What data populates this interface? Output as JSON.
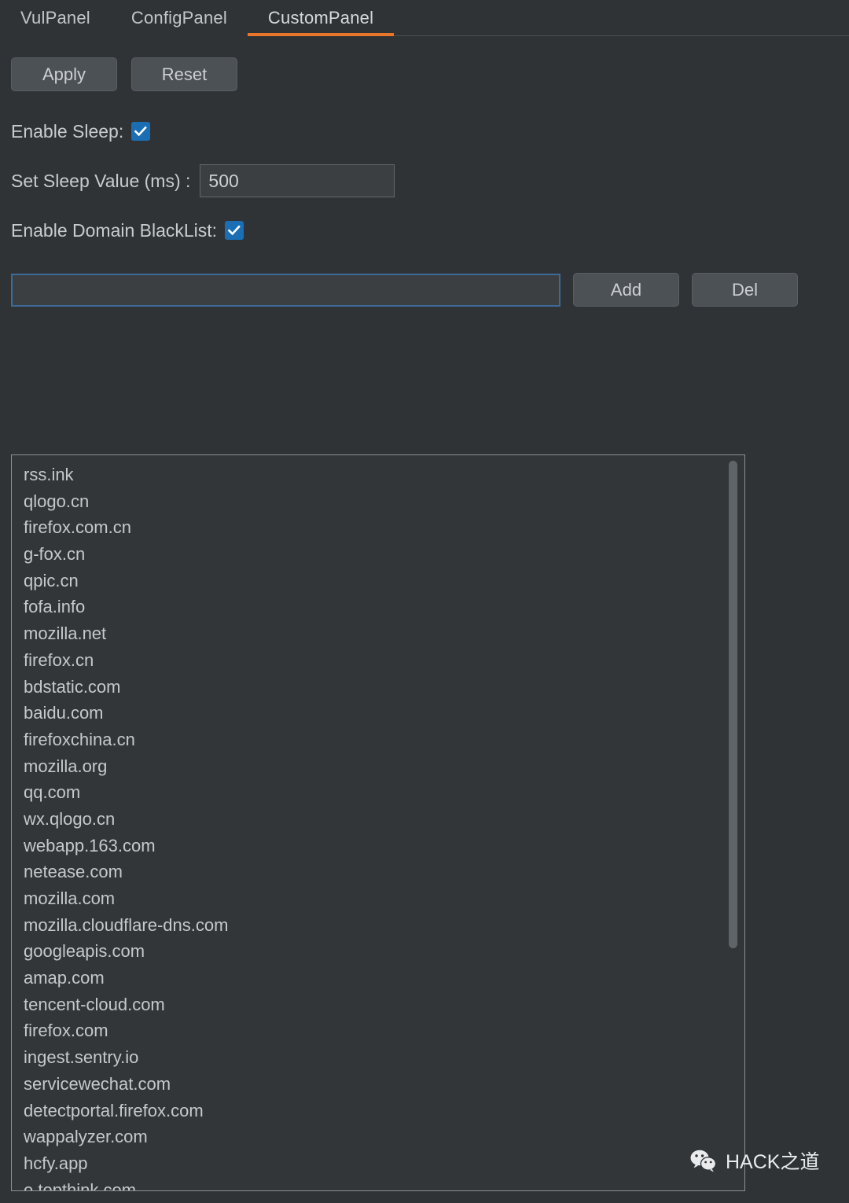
{
  "tabs": [
    {
      "label": "VulPanel",
      "active": false
    },
    {
      "label": "ConfigPanel",
      "active": false
    },
    {
      "label": "CustomPanel",
      "active": true
    }
  ],
  "toolbar": {
    "apply_label": "Apply",
    "reset_label": "Reset"
  },
  "settings": {
    "enable_sleep_label": "Enable Sleep:",
    "enable_sleep_checked": true,
    "sleep_value_label": "Set Sleep Value (ms) :",
    "sleep_value": "500",
    "enable_blacklist_label": "Enable Domain BlackList:",
    "enable_blacklist_checked": true
  },
  "domain_entry": {
    "value": "",
    "placeholder": "",
    "add_label": "Add",
    "del_label": "Del"
  },
  "blacklist": [
    "rss.ink",
    "qlogo.cn",
    "firefox.com.cn",
    "g-fox.cn",
    "qpic.cn",
    "fofa.info",
    "mozilla.net",
    "firefox.cn",
    "bdstatic.com",
    "baidu.com",
    "firefoxchina.cn",
    "mozilla.org",
    "qq.com",
    "wx.qlogo.cn",
    "webapp.163.com",
    "netease.com",
    "mozilla.com",
    "mozilla.cloudflare-dns.com",
    "googleapis.com",
    "amap.com",
    "tencent-cloud.com",
    "firefox.com",
    "ingest.sentry.io",
    "servicewechat.com",
    "detectportal.firefox.com",
    "wappalyzer.com",
    "hcfy.app",
    "e.topthink.com"
  ],
  "watermark": {
    "text": "HACK之道",
    "icon": "wechat-icon"
  },
  "colors": {
    "background": "#303336",
    "accent": "#e8752a",
    "checkbox": "#1a6fb4",
    "focus_border": "#3d6a99",
    "button": "#4b5155",
    "text": "#c9ccce"
  }
}
